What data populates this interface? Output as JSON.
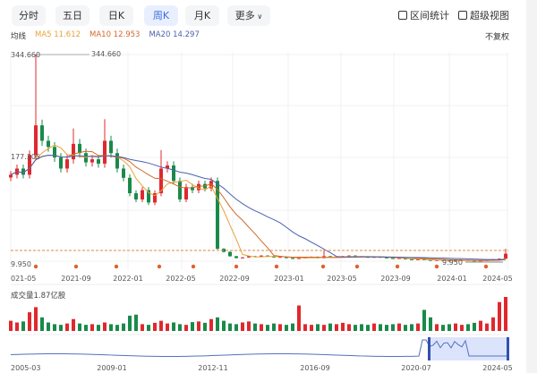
{
  "tabs": [
    {
      "label": "分时"
    },
    {
      "label": "五日"
    },
    {
      "label": "日K"
    },
    {
      "label": "周K",
      "active": true
    },
    {
      "label": "月K"
    },
    {
      "label": "更多"
    }
  ],
  "tools": {
    "range_stats": "区间统计",
    "super_view": "超级视图"
  },
  "legend": {
    "title": "均线",
    "ma5": "MA5 11.612",
    "ma10": "MA10 12.953",
    "ma20": "MA20 14.297"
  },
  "adjust": "不复权",
  "colors": {
    "up": "#e0282e",
    "down": "#1a8a4a",
    "ma5": "#e8a23a",
    "ma10": "#d2692a",
    "ma20": "#4a62b0",
    "accent": "#3c6ee0"
  },
  "volume_label": "成交量1.87亿股",
  "chart_data": {
    "type": "candlestick",
    "period": "weekly",
    "ylim": [
      9.95,
      344.66
    ],
    "price_labels": {
      "max": "344.660",
      "max_marker": "344.660",
      "mid": "177.305",
      "min": "9.950",
      "min_marker": "9.950"
    },
    "x_ticks": [
      "021-05",
      "2021-09",
      "2022-01",
      "2022-05",
      "2022-09",
      "2023-01",
      "2023-05",
      "2023-09",
      "2024-01",
      "2024-05"
    ],
    "closes": [
      150,
      160,
      150,
      182,
      230,
      205,
      195,
      178,
      160,
      175,
      200,
      185,
      170,
      175,
      168,
      205,
      185,
      160,
      145,
      120,
      110,
      125,
      105,
      120,
      160,
      165,
      140,
      110,
      130,
      125,
      135,
      128,
      140,
      30,
      25,
      18,
      15,
      16,
      18,
      17,
      19,
      18,
      16,
      17,
      15,
      14,
      15,
      16,
      17,
      15,
      18,
      16,
      17,
      18,
      19,
      18,
      17,
      16,
      17,
      16,
      15,
      14,
      15,
      13,
      12,
      13,
      12,
      11,
      12,
      11,
      10.5,
      11,
      12,
      11,
      10.5,
      11,
      12,
      13,
      14,
      22
    ],
    "spike_highs": {
      "4": 344.66,
      "10": 225,
      "15": 240,
      "24": 190,
      "50": 28,
      "79": 30
    },
    "volume": [
      30,
      25,
      28,
      55,
      70,
      40,
      25,
      20,
      18,
      22,
      35,
      22,
      18,
      20,
      18,
      25,
      20,
      18,
      22,
      45,
      48,
      20,
      18,
      24,
      30,
      22,
      25,
      20,
      18,
      26,
      28,
      24,
      35,
      40,
      30,
      22,
      20,
      25,
      28,
      22,
      20,
      18,
      22,
      20,
      18,
      22,
      75,
      20,
      18,
      20,
      18,
      22,
      20,
      24,
      20,
      18,
      20,
      18,
      22,
      20,
      18,
      20,
      22,
      18,
      20,
      22,
      62,
      40,
      20,
      18,
      20,
      22,
      18,
      20,
      24,
      30,
      22,
      40,
      85,
      100
    ],
    "navigator": {
      "x_ticks": [
        "2005-03",
        "2009-01",
        "2012-11",
        "2016-09",
        "2020-07",
        "2024-05"
      ]
    }
  }
}
